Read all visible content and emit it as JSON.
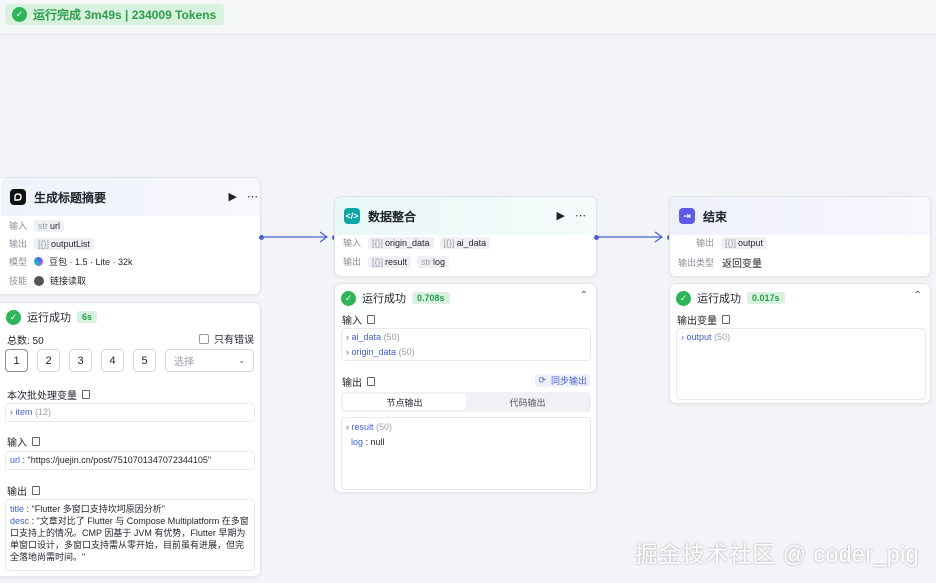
{
  "top_status": {
    "text": "运行完成 3m49s | 234009 Tokens"
  },
  "node1": {
    "title": "生成标题摘要",
    "rows": [
      {
        "key": "输入",
        "type": "str",
        "value": "url"
      },
      {
        "key": "输出",
        "type": "[{}]",
        "value": "outputList"
      },
      {
        "key": "模型",
        "value": "豆包 · 1.5 · Lite · 32k"
      },
      {
        "key": "技能",
        "value": "链接读取"
      }
    ]
  },
  "node1_result": {
    "status": "运行成功",
    "duration": "6s",
    "total": "总数: 50",
    "only_errors": "只有错误",
    "pages": [
      "1",
      "2",
      "3",
      "4",
      "5"
    ],
    "select_placeholder": "选择",
    "batch_vars_label": "本次批处理变量",
    "batch_var": {
      "name": "item",
      "count": "(12)"
    },
    "input_label": "输入",
    "input_line": {
      "key": "url",
      "value": "\"https://juejin.cn/post/7510701347072344105\""
    },
    "output_label": "输出",
    "output_lines": [
      {
        "key": "title",
        "value": "\"Flutter 多窗口支持坎坷原因分析\""
      },
      {
        "key": "desc",
        "value": "\"文章对比了 Flutter 与 Compose Multiplatform 在多窗口支持上的情况。CMP 因基于 JVM 有优势，Flutter 早期为单窗口设计，多窗口支持需从零开始，目前虽有进展，但完全落地尚需时间。\""
      }
    ]
  },
  "node2": {
    "title": "数据整合",
    "rows": [
      {
        "key": "输入",
        "tags": [
          {
            "type": "[{}]",
            "value": "origin_data"
          },
          {
            "type": "[{}]",
            "value": "ai_data"
          }
        ]
      },
      {
        "key": "输出",
        "tags": [
          {
            "type": "[{}]",
            "value": "result"
          },
          {
            "type": "str",
            "value": "log"
          }
        ]
      }
    ]
  },
  "node2_result": {
    "status": "运行成功",
    "duration": "0.708s",
    "input_label": "输入",
    "inputs": [
      {
        "name": "ai_data",
        "count": "(50)"
      },
      {
        "name": "origin_data",
        "count": "(50)"
      }
    ],
    "output_label": "输出",
    "sync_label": "同步输出",
    "tabs": [
      "节点输出",
      "代码输出"
    ],
    "outputs": [
      {
        "name": "result",
        "count": "(50)"
      },
      {
        "name": "log",
        "value": "null"
      }
    ]
  },
  "node3": {
    "title": "结束",
    "row1": {
      "key": "输出",
      "type": "[{}]",
      "value": "output"
    },
    "row2": {
      "key": "输出类型",
      "value": "返回变量"
    }
  },
  "node3_result": {
    "status": "运行成功",
    "duration": "0.017s",
    "var_label": "输出变量",
    "var": {
      "name": "output",
      "count": "(50)"
    }
  },
  "watermark": "掘金技术社区 @ coder_pig",
  "colors": {
    "success": "#2fb559",
    "accent": "#4c5fd5",
    "code_icon": "#0aa6a8",
    "end_icon": "#5b5be8"
  }
}
